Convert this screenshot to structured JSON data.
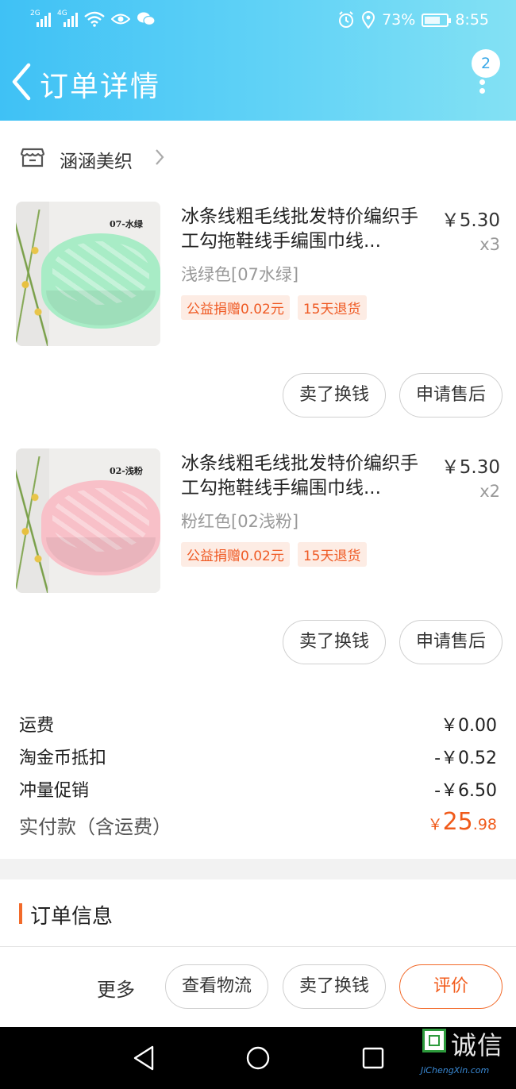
{
  "status_bar": {
    "sig1": "2G",
    "sig2": "4G",
    "battery_pct_text": "73%",
    "battery_level": 0.73,
    "time": "8:55"
  },
  "header": {
    "title": "订单详情",
    "badge": "2"
  },
  "shop": {
    "name": "涵涵美织"
  },
  "items": [
    {
      "name": "冰条线粗毛线批发特价编织手工勾拖鞋线手编围巾线...",
      "price": "￥5.30",
      "qty": "x3",
      "sku": "浅绿色[07水绿]",
      "tag_charity": "公益捐赠0.02元",
      "tag_return": "15天退货",
      "thumb_label": "07-水绿",
      "yarn_color": "#a8ecc6",
      "btn_sell": "卖了换钱",
      "btn_after": "申请售后"
    },
    {
      "name": "冰条线粗毛线批发特价编织手工勾拖鞋线手编围巾线...",
      "price": "￥5.30",
      "qty": "x2",
      "sku": "粉红色[02浅粉]",
      "tag_charity": "公益捐赠0.02元",
      "tag_return": "15天退货",
      "thumb_label": "02-浅粉",
      "yarn_color": "#f8c0c8",
      "btn_sell": "卖了换钱",
      "btn_after": "申请售后"
    }
  ],
  "totals": {
    "shipping_label": "运费",
    "shipping_value": "￥0.00",
    "coin_label": "淘金币抵扣",
    "coin_value": "-￥0.52",
    "promo_label": "冲量促销",
    "promo_value": "-￥6.50",
    "paid_label": "实付款（含运费）",
    "paid_currency": "￥",
    "paid_int": "25",
    "paid_dec": ".98"
  },
  "order_info": {
    "title": "订单信息"
  },
  "action_bar": {
    "more": "更多",
    "logistics": "查看物流",
    "sell": "卖了换钱",
    "review": "评价"
  },
  "watermark": {
    "cn": "诚信",
    "en": "JiChengXin.com"
  },
  "colors": {
    "header_gradient_start": "#3fc1f5",
    "header_gradient_end": "#83e1f4",
    "accent_orange": "#f25c1c",
    "tag_bg": "#fdece4"
  }
}
